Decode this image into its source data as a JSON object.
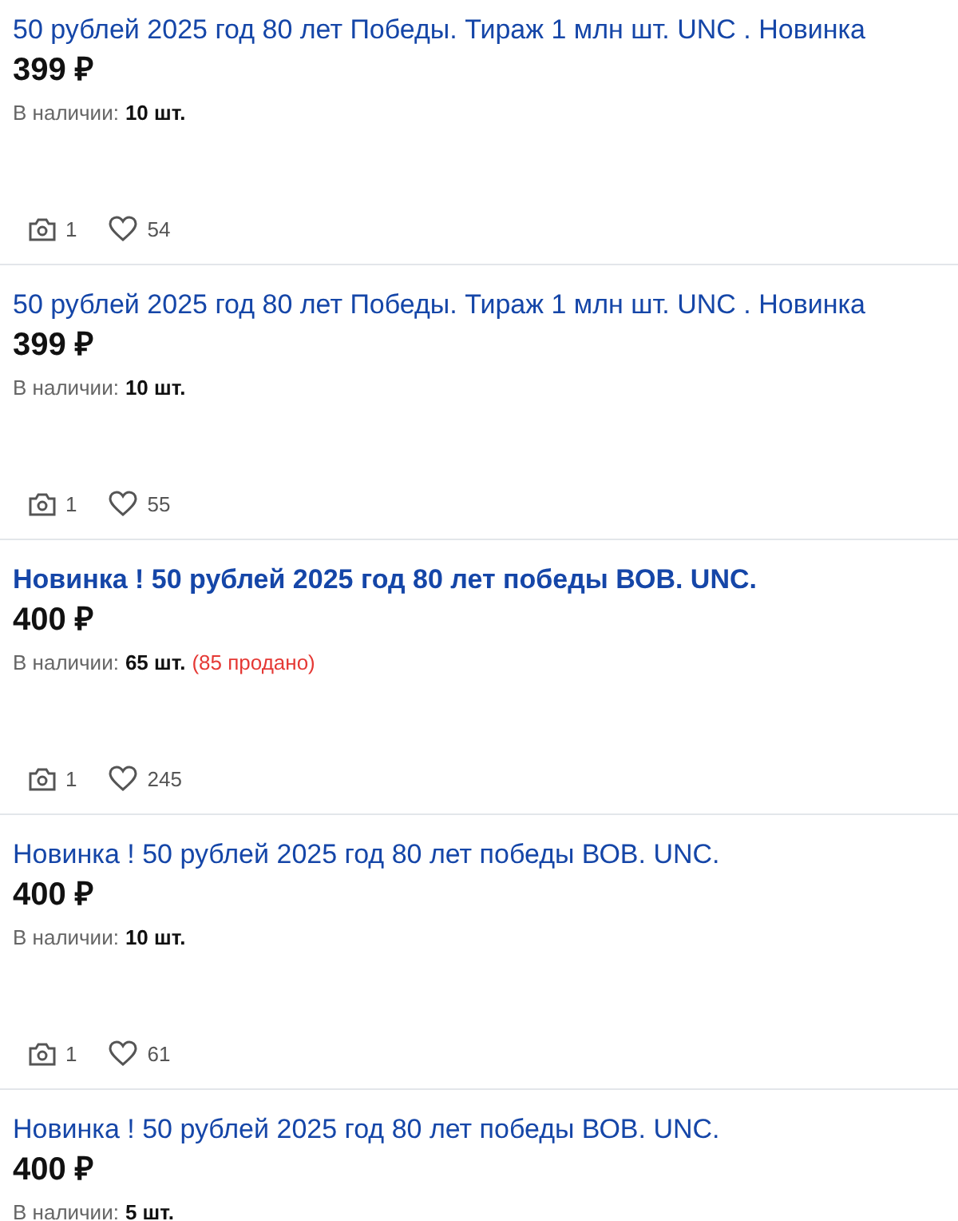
{
  "listings": [
    {
      "title": "50 рублей 2025 год 80 лет Победы. Тираж 1 млн шт. UNC . Новинка",
      "bold_title": false,
      "price": "399 ₽",
      "stock_label": "В наличии:",
      "stock": "10 шт.",
      "photos": "1",
      "likes": "54"
    },
    {
      "title": "50 рублей 2025 год 80 лет Победы. Тираж 1 млн шт. UNC . Новинка",
      "bold_title": false,
      "price": "399 ₽",
      "stock_label": "В наличии:",
      "stock": "10 шт.",
      "photos": "1",
      "likes": "55"
    },
    {
      "title": "Новинка ! 50 рублей 2025 год 80 лет победы ВОВ. UNC.",
      "bold_title": true,
      "price": "400 ₽",
      "stock_label": "В наличии:",
      "stock": "65 шт.",
      "sold": "(85 продано)",
      "photos": "1",
      "likes": "245"
    },
    {
      "title": "Новинка ! 50 рублей 2025 год 80 лет победы ВОВ. UNC.",
      "bold_title": false,
      "price": "400 ₽",
      "stock_label": "В наличии:",
      "stock": "10 шт.",
      "photos": "1",
      "likes": "61"
    },
    {
      "title": "Новинка ! 50 рублей 2025 год 80 лет победы ВОВ. UNC.",
      "bold_title": false,
      "price": "400 ₽",
      "stock_label": "В наличии:",
      "stock": "5 шт."
    }
  ]
}
